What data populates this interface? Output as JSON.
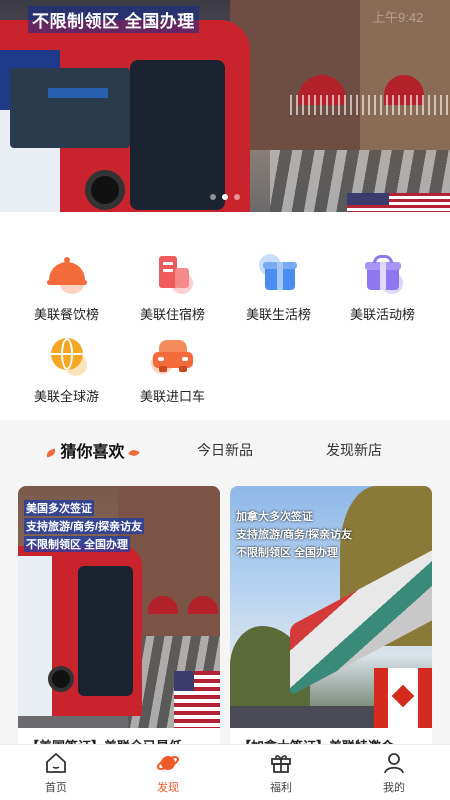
{
  "banner": {
    "headline": "不限制领区 全国办理",
    "clock": "上午9:42",
    "active_dot": 1,
    "dot_count": 3
  },
  "categories": [
    {
      "label": "美联餐饮榜",
      "icon": "dining-cloche-icon",
      "color": "#f36a3b"
    },
    {
      "label": "美联住宿榜",
      "icon": "hotel-building-icon",
      "color": "#f05a5a"
    },
    {
      "label": "美联生活榜",
      "icon": "gift-box-icon",
      "color": "#4a8cf0"
    },
    {
      "label": "美联活动榜",
      "icon": "present-icon",
      "color": "#8d78f0"
    },
    {
      "label": "美联全球游",
      "icon": "globe-icon",
      "color": "#f5a623"
    },
    {
      "label": "美联进口车",
      "icon": "car-icon",
      "color": "#f36a3b"
    }
  ],
  "tabs": [
    {
      "label": "猜你喜欢",
      "active": true
    },
    {
      "label": "今日新品",
      "active": false
    },
    {
      "label": "发现新店",
      "active": false
    }
  ],
  "cards": [
    {
      "overlay_lines": [
        "美国多次签证",
        "支持旅游/商务/探亲访友",
        "不限制领区 全国办理"
      ],
      "title": "【美国签证】美联全已是低",
      "flag": "us-flag"
    },
    {
      "overlay_lines": [
        "加拿大多次签证",
        "支持旅游/商务/探亲访友",
        "不限制领区 全国办理"
      ],
      "title": "【加拿大签证】美联特邀会",
      "flag": "canada-flag"
    }
  ],
  "nav": [
    {
      "label": "首页",
      "icon": "home-icon",
      "active": false
    },
    {
      "label": "发现",
      "icon": "planet-icon",
      "active": true
    },
    {
      "label": "福利",
      "icon": "gift-icon",
      "active": false
    },
    {
      "label": "我的",
      "icon": "user-icon",
      "active": false
    }
  ],
  "colors": {
    "accent": "#f05a2a",
    "background": "#f5f5f5"
  }
}
